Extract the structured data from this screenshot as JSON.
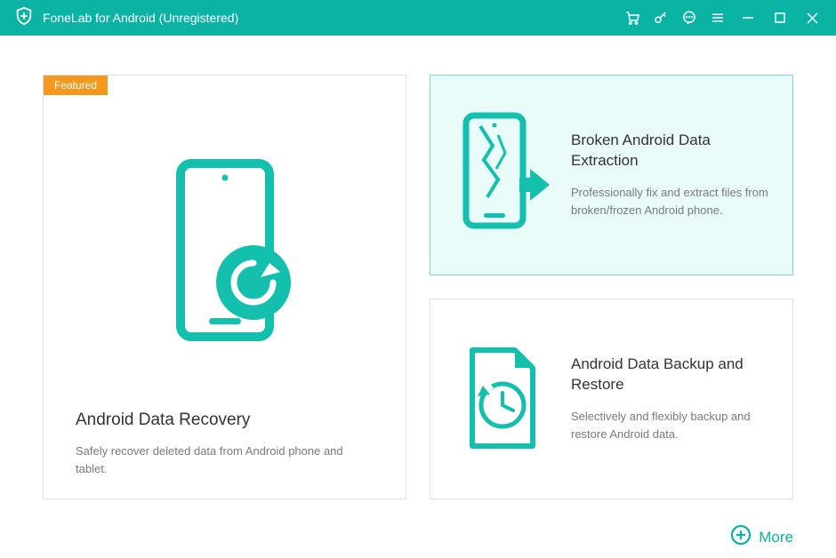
{
  "app": {
    "title": "FoneLab for Android (Unregistered)"
  },
  "featuredBadge": "Featured",
  "cards": {
    "recovery": {
      "title": "Android Data Recovery",
      "desc": "Safely recover deleted data from Android phone and tablet."
    },
    "extraction": {
      "title": "Broken Android Data Extraction",
      "desc": "Professionally fix and extract files from broken/frozen Android phone."
    },
    "backup": {
      "title": "Android Data Backup and Restore",
      "desc": "Selectively and flexibly backup and restore Android data."
    }
  },
  "moreLabel": "More"
}
